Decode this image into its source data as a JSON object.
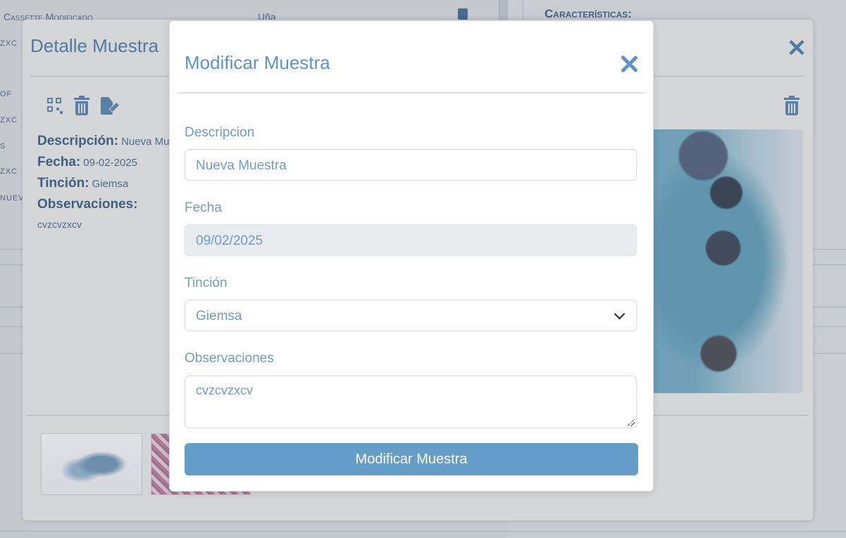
{
  "background": {
    "table_header_first": "Cassette Modificado",
    "table_header_second": "Uña",
    "row_fragments": [
      "ZXC",
      "OF",
      "ZXC",
      "S",
      "ZXC",
      "NUEV"
    ],
    "right_panel_heading": "Características:"
  },
  "detail": {
    "title": "Detalle Muestra",
    "close_symbol": "✕",
    "descripcion_label": "Descripción:",
    "descripcion_value": "Nueva Mu",
    "fecha_label": "Fecha:",
    "fecha_value": "09-02-2025",
    "tincion_label": "Tinción:",
    "tincion_value": "Giemsa",
    "observaciones_label": "Observaciones:",
    "observaciones_value": "cvzcvzxcv"
  },
  "modal": {
    "title": "Modificar Muestra",
    "descripcion_label": "Descripcion",
    "descripcion_value": "Nueva Muestra",
    "fecha_label": "Fecha",
    "fecha_value": "09/02/2025",
    "tincion_label": "Tinción",
    "tincion_selected": "Giemsa",
    "observaciones_label": "Observaciones",
    "observaciones_value": "cvzcvzxcv",
    "submit_label": "Modificar Muestra"
  },
  "colors": {
    "accent": "#659dc9",
    "title_blue": "#5f93c5",
    "label_blue": "#6f9dc7"
  }
}
